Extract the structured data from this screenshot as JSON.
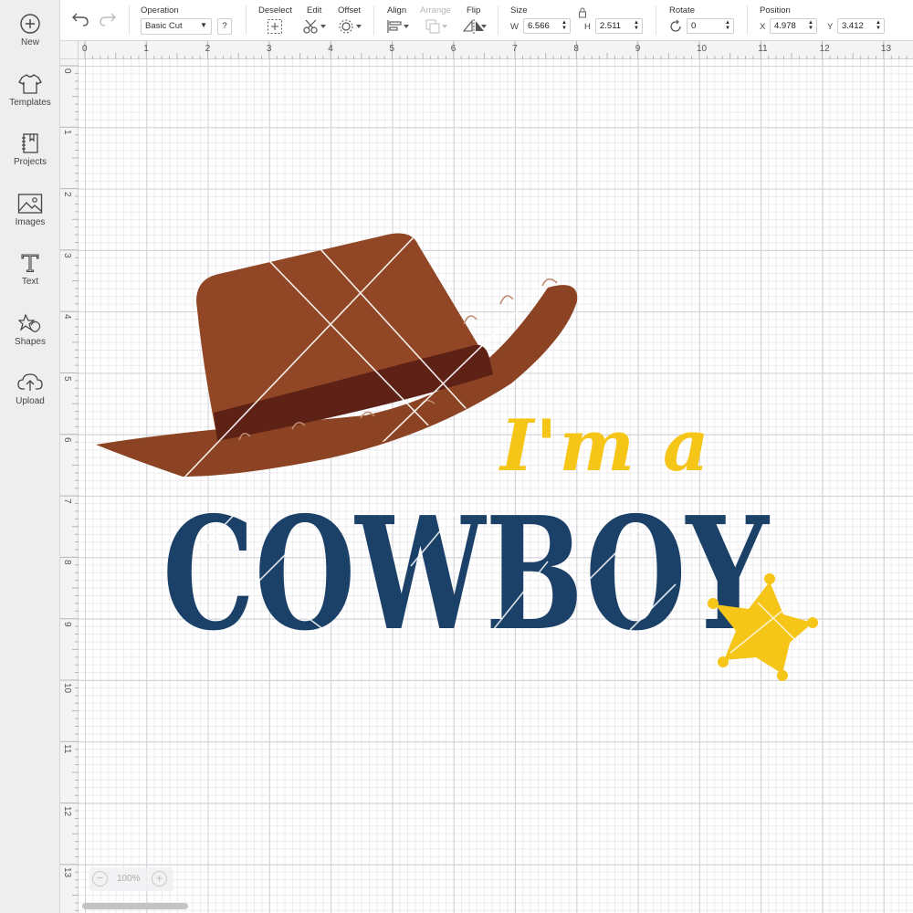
{
  "sidebar": {
    "items": [
      {
        "label": "New",
        "icon": "plus-circle-icon"
      },
      {
        "label": "Templates",
        "icon": "tshirt-icon"
      },
      {
        "label": "Projects",
        "icon": "notebook-icon"
      },
      {
        "label": "Images",
        "icon": "image-icon"
      },
      {
        "label": "Text",
        "icon": "text-t-icon"
      },
      {
        "label": "Shapes",
        "icon": "shapes-icon"
      },
      {
        "label": "Upload",
        "icon": "cloud-upload-icon"
      }
    ]
  },
  "toolbar": {
    "operation_label": "Operation",
    "operation_value": "Basic Cut",
    "help": "?",
    "deselect_label": "Deselect",
    "edit_label": "Edit",
    "offset_label": "Offset",
    "align_label": "Align",
    "arrange_label": "Arrange",
    "flip_label": "Flip",
    "size_label": "Size",
    "w_label": "W",
    "w_value": "6.566",
    "h_label": "H",
    "h_value": "2.511",
    "rotate_label": "Rotate",
    "rotate_value": "0",
    "position_label": "Position",
    "x_label": "X",
    "x_value": "4.978",
    "y_label": "Y",
    "y_value": "3.412"
  },
  "ruler": {
    "top": [
      "0",
      "1",
      "2",
      "3",
      "4",
      "5",
      "6",
      "7",
      "8",
      "9",
      "10",
      "11",
      "12",
      "13"
    ],
    "left": [
      "0",
      "1",
      "2",
      "3",
      "4",
      "5",
      "6",
      "7",
      "8",
      "9",
      "10",
      "11",
      "12",
      "13"
    ]
  },
  "design": {
    "line1": "I'm a",
    "line2": "COWBOY",
    "colors": {
      "hat": "#8f4524",
      "hat_dark": "#a0532b",
      "band": "#5e2116",
      "title": "#1b4168",
      "accent": "#f5c518"
    }
  },
  "zoom": {
    "minus": "−",
    "value": "100%",
    "plus": "+"
  }
}
